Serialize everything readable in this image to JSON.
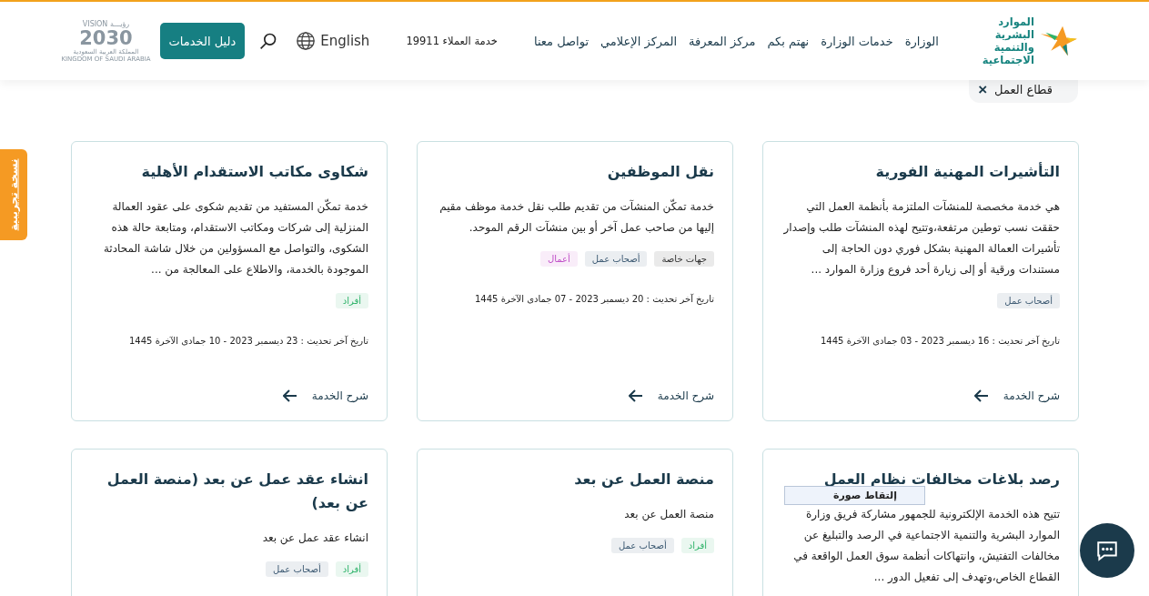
{
  "header": {
    "logo": {
      "line_1": "الموارد البشرية",
      "line_2": "والتنمية الاجتماعية"
    },
    "nav": [
      "الوزارة",
      "خدمات الوزارة",
      "نهتم بكم",
      "مركز المعرفة",
      "المركز الإعلامي",
      "تواصل معنا"
    ],
    "customer_service": "خدمة العملاء 19911",
    "language": "English",
    "guide_button": "دليل الخدمات",
    "vision_logo": {
      "top": "VISION رؤيـــة",
      "year": "2030",
      "arabic": "المملكة العربية السعودية",
      "english": "KINGDOM OF SAUDI ARABIA"
    }
  },
  "filter_chip": {
    "label": "قطاع العمل",
    "remove": "×"
  },
  "side_tab": "نسخة تجريبية",
  "cards": [
    {
      "title": "التأشيرات المهنية الفورية",
      "description": "هي خدمة مخصصة للمنشآت الملتزمة بأنظمة العمل التي حققت نسب توطين مرتفعة،وتتيح لهذه المنشآت طلب وإصدار تأشيرات العمالة المهنية بشكل فوري دون الحاجة إلى مستندات ورقية أو إلى زيارة أحد فروع وزارة الموارد ...",
      "tags": [
        {
          "label": "أصحاب عمل",
          "color": "#3d5a73"
        }
      ],
      "updated": "تاريخ آخر تحديث : 16 ديسمبر 2023 - 03 جمادى الآخرة 1445",
      "link": "شرح الخدمة"
    },
    {
      "title": "نقل الموظفين",
      "description": "خدمة تمكّن المنشآت من تقديم طلب نقل خدمة موظف مقيم إليها من صاحب عمل آخر أو بين منشآت الرقم الموحد.",
      "tags": [
        {
          "label": "جهات خاصة",
          "color": "#333333"
        },
        {
          "label": "أصحاب عمل",
          "color": "#3d5a73"
        },
        {
          "label": "أعمال",
          "color": "#c04fc8"
        }
      ],
      "updated": "تاريخ آخر تحديث : 20 ديسمبر 2023 - 07 جمادى الآخرة 1445",
      "link": "شرح الخدمة"
    },
    {
      "title": "شكاوى مكاتب الاستقدام الأهلية",
      "description": "خدمة تمكّن المستفيد من تقديم شكوى على عقود العمالة المنزلية إلى شركات ومكاتب الاستقدام، ومتابعة حالة هذه الشكوى، والتواصل مع المسؤولين من خلال شاشة المحادثة الموجودة بالخدمة، والاطلاع على المعالجة من ...",
      "tags": [
        {
          "label": "أفراد",
          "color": "#2fb36a"
        }
      ],
      "updated": "تاريخ آخر تحديث : 23 ديسمبر 2023 - 10 جمادى الآخرة 1445",
      "link": "شرح الخدمة"
    },
    {
      "title": "رصد بلاغات مخالفات نظام العمل",
      "description": "تتيح هذه الخدمة الإلكترونية للجمهور مشاركة فريق وزارة الموارد البشرية والتنمية الاجتماعية في الرصد والتبليغ عن مخالفات التفتيش، وانتهاكات أنظمة سوق العمل الواقعة في القطاع الخاص،وتهدف إلى تفعيل الدور ...",
      "tooltip": "إلتقاط صورة"
    },
    {
      "title": "منصة العمل عن بعد",
      "description": "منصة العمل عن بعد",
      "tags": [
        {
          "label": "أفراد",
          "color": "#2fb36a"
        },
        {
          "label": "أصحاب عمل",
          "color": "#3d5a73"
        }
      ]
    },
    {
      "title": "انشاء عقد عمل عن بعد (منصة العمل عن بعد)",
      "description": "انشاء عقد عمل عن بعد",
      "tags": [
        {
          "label": "أفراد",
          "color": "#2fb36a"
        },
        {
          "label": "أصحاب عمل",
          "color": "#3d5a73"
        }
      ]
    }
  ]
}
